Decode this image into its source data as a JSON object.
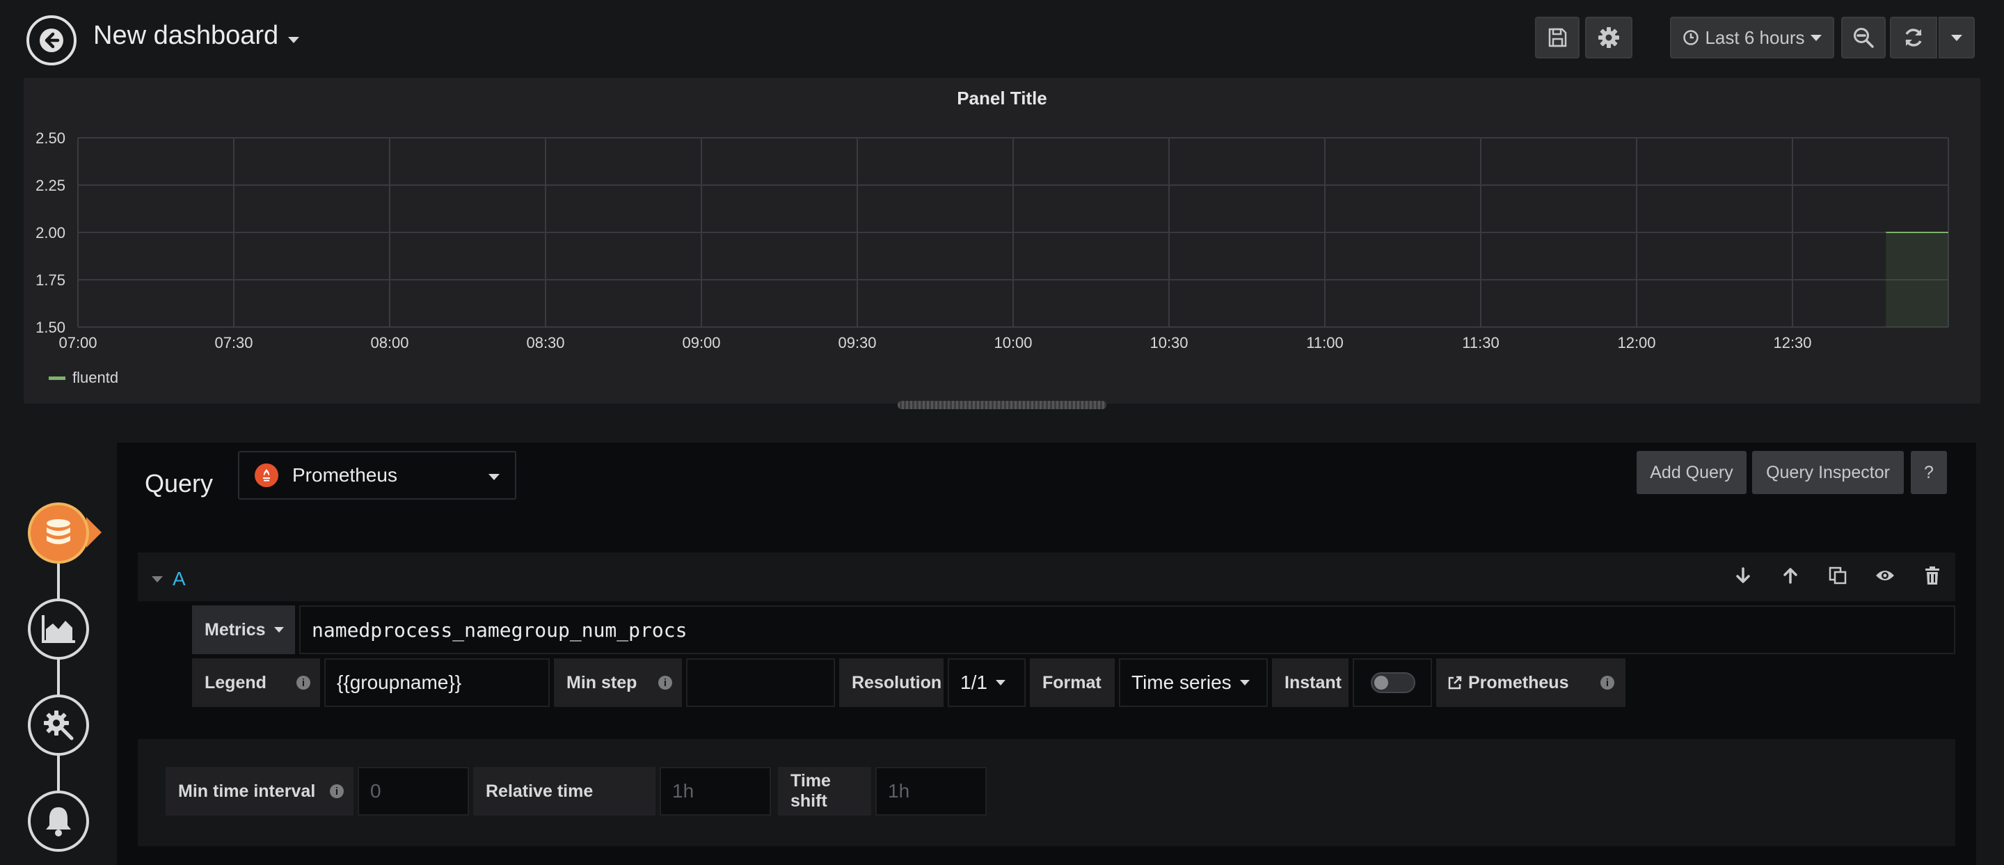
{
  "topbar": {
    "title": "New dashboard",
    "time_range": "Last 6 hours"
  },
  "panel": {
    "title": "Panel Title",
    "legend": [
      {
        "name": "fluentd",
        "color": "#7eb26d"
      }
    ]
  },
  "chart_data": {
    "type": "line",
    "title": "Panel Title",
    "x_ticks": [
      "07:00",
      "07:30",
      "08:00",
      "08:30",
      "09:00",
      "09:30",
      "10:00",
      "10:30",
      "11:00",
      "11:30",
      "12:00",
      "12:30"
    ],
    "y_ticks": [
      "1.50",
      "1.75",
      "2.00",
      "2.25",
      "2.50"
    ],
    "ylim": [
      1.5,
      2.5
    ],
    "xlim": [
      "07:00",
      "13:00"
    ],
    "grid": true,
    "legend_position": "bottom-left",
    "series": [
      {
        "name": "fluentd",
        "color": "#7eb26d",
        "x": [
          "12:48",
          "13:00"
        ],
        "y": [
          2.0,
          2.0
        ]
      }
    ]
  },
  "editor": {
    "query_label": "Query",
    "datasource": "Prometheus",
    "add_query_label": "Add Query",
    "query_inspector_label": "Query Inspector",
    "help_label": "?",
    "query_row": {
      "ref_id": "A",
      "metrics_label": "Metrics",
      "metrics_value": "namedprocess_namegroup_num_procs",
      "legend_label": "Legend",
      "legend_value": "{{groupname}}",
      "min_step_label": "Min step",
      "min_step_value": "",
      "resolution_label": "Resolution",
      "resolution_value": "1/1",
      "format_label": "Format",
      "format_value": "Time series",
      "instant_label": "Instant",
      "instant_enabled": false,
      "prometheus_link_label": "Prometheus"
    },
    "options": {
      "min_time_interval_label": "Min time interval",
      "min_time_interval_placeholder": "0",
      "relative_time_label": "Relative time",
      "relative_time_placeholder": "1h",
      "time_shift_label": "Time shift",
      "time_shift_placeholder": "1h"
    }
  },
  "rail": {
    "items": [
      {
        "name": "queries",
        "icon": "database-icon",
        "active": true
      },
      {
        "name": "visualization",
        "icon": "area-chart-icon",
        "active": false
      },
      {
        "name": "general",
        "icon": "gear-wrench-icon",
        "active": false
      },
      {
        "name": "alert",
        "icon": "bell-icon",
        "active": false
      }
    ]
  }
}
